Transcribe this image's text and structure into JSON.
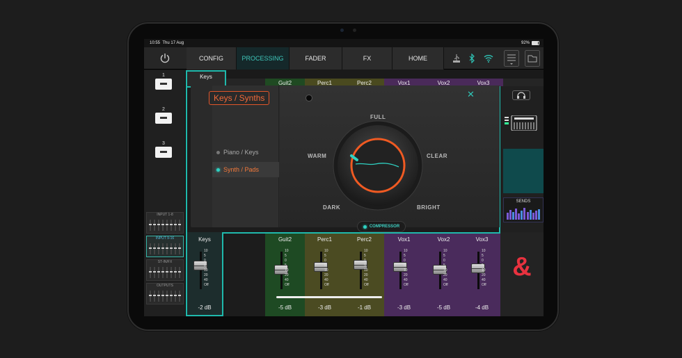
{
  "status": {
    "time": "10:55",
    "date": "Thu 17 Aug",
    "battery": "92%"
  },
  "topnav": {
    "tabs": [
      "CONFIG",
      "PROCESSING",
      "FADER",
      "FX",
      "HOME"
    ],
    "active": "PROCESSING"
  },
  "icons": {
    "power": "power-icon",
    "usb": "usb-icon",
    "bluetooth": "bluetooth-icon",
    "wifi": "wifi-icon",
    "menu": "menu-icon",
    "folder": "folder-icon",
    "headphones": "headphones-icon",
    "keyboard": "keyboard-icon",
    "close": "close-icon"
  },
  "scenes": [
    "1",
    "2",
    "3"
  ],
  "banks": [
    "INPUT 1-8",
    "INPUT 9-16",
    "ST-IN/FX",
    "OUTPUTS"
  ],
  "selected_bank": "INPUT 9-16",
  "channel_tabs": [
    {
      "name": "Keys",
      "color": "#2a2a2a"
    },
    {
      "name": "",
      "color": "#252525"
    },
    {
      "name": "Guit2",
      "color": "#1f4a22"
    },
    {
      "name": "Perc1",
      "color": "#4a4a1f"
    },
    {
      "name": "Perc2",
      "color": "#4a4a1f"
    },
    {
      "name": "Vox1",
      "color": "#4a2a5a"
    },
    {
      "name": "Vox2",
      "color": "#4a2a5a"
    },
    {
      "name": "Vox3",
      "color": "#4a2a5a"
    }
  ],
  "preset": {
    "title": "Keys / Synths",
    "items": [
      {
        "label": "Piano / Keys",
        "selected": false
      },
      {
        "label": "Synth / Pads",
        "selected": true
      }
    ]
  },
  "dial": {
    "labels": {
      "top": "FULL",
      "left": "WARM",
      "right": "CLEAR",
      "bottom_left": "DARK",
      "bottom_right": "BRIGHT"
    },
    "accent": "#f05a22",
    "indicator": "#2fd1c2"
  },
  "compressor": {
    "label": "COMPRESSOR"
  },
  "sends": {
    "label": "SENDS",
    "levels": [
      0.55,
      0.8,
      0.6,
      0.9,
      0.5,
      0.7,
      0.95,
      0.6,
      0.8,
      0.55,
      0.7,
      0.85
    ]
  },
  "amp_logo": "&",
  "scale_marks": [
    "10",
    "5",
    "0",
    "5",
    "10",
    "20",
    "40",
    "Off"
  ],
  "faders": [
    {
      "name": "Keys",
      "db": "-2 dB",
      "level": 0.72,
      "bg": "#1d2d2d"
    },
    {
      "name": "",
      "db": "",
      "level": null,
      "bg": "#1c1c1c"
    },
    {
      "name": "Guit2",
      "db": "-5 dB",
      "level": 0.62,
      "bg": "#1e4a23"
    },
    {
      "name": "Perc1",
      "db": "-3 dB",
      "level": 0.68,
      "bg": "#4b4b22"
    },
    {
      "name": "Perc2",
      "db": "-1 dB",
      "level": 0.74,
      "bg": "#4b4b22"
    },
    {
      "name": "Vox1",
      "db": "-3 dB",
      "level": 0.68,
      "bg": "#4a2b5c"
    },
    {
      "name": "Vox2",
      "db": "-5 dB",
      "level": 0.62,
      "bg": "#4a2b5c"
    },
    {
      "name": "Vox3",
      "db": "-4 dB",
      "level": 0.65,
      "bg": "#4a2b5c"
    }
  ],
  "accent_teal": "#1fb9ac"
}
